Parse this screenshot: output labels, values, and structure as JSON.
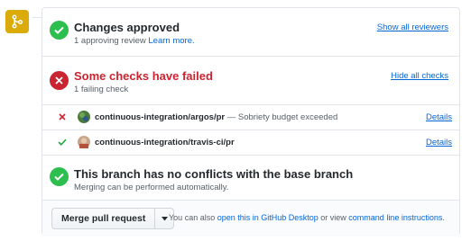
{
  "approved": {
    "title": "Changes approved",
    "subtitle": "1 approving review",
    "learn_more": "Learn more.",
    "show_reviewers": "Show all reviewers"
  },
  "checks": {
    "title": "Some checks have failed",
    "subtitle": "1 failing check",
    "hide_checks": "Hide all checks",
    "rows": [
      {
        "status": "failure",
        "name": "continuous-integration/argos/pr",
        "description": " — Sobriety budget exceeded",
        "details": "Details"
      },
      {
        "status": "success",
        "name": "continuous-integration/travis-ci/pr",
        "description": "",
        "details": "Details"
      }
    ]
  },
  "conflicts": {
    "title": "This branch has no conflicts with the base branch",
    "subtitle": "Merging can be performed automatically."
  },
  "merge": {
    "button_label": "Merge pull request",
    "note_prefix": "You can also ",
    "desktop_link": "open this in GitHub Desktop",
    "note_middle": " or view ",
    "cli_link": "command line instructions",
    "note_suffix": "."
  },
  "icons": {
    "merge": "git-merge-icon",
    "approved": "check-circle-icon",
    "failed": "x-circle-icon",
    "row_fail": "x-icon",
    "row_success": "check-icon",
    "dropdown": "caret-down-icon"
  },
  "colors": {
    "green": "#2cbe4e",
    "red": "#cb2431",
    "link": "#0366d6",
    "merge_icon_bg": "#dbab09"
  }
}
